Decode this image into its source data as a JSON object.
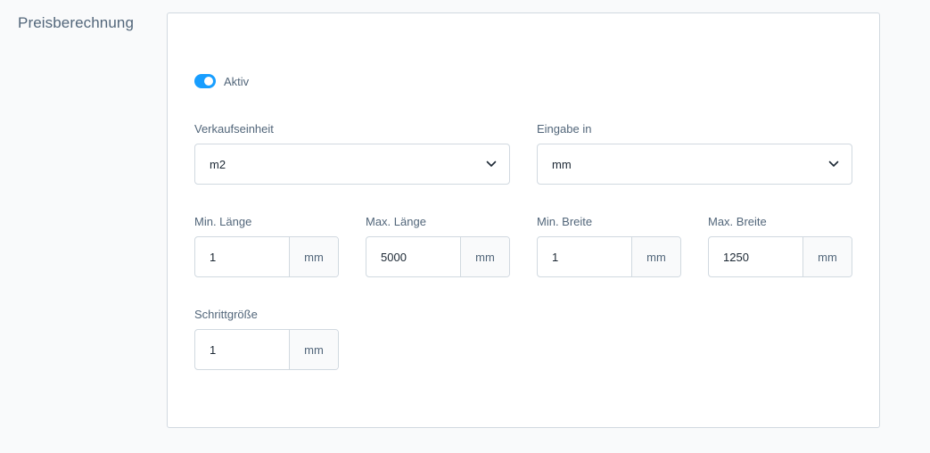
{
  "section": {
    "title": "Preisberechnung"
  },
  "toggle": {
    "label": "Aktiv",
    "checked": true,
    "color": "#189eff"
  },
  "selects": {
    "sales_unit": {
      "label": "Verkaufseinheit",
      "value": "m2",
      "icon": "chevron-down-icon"
    },
    "input_unit": {
      "label": "Eingabe in",
      "value": "mm",
      "icon": "chevron-down-icon"
    }
  },
  "dimensions": {
    "min_length": {
      "label": "Min. Länge",
      "value": "1",
      "unit": "mm"
    },
    "max_length": {
      "label": "Max. Länge",
      "value": "5000",
      "unit": "mm"
    },
    "min_width": {
      "label": "Min. Breite",
      "value": "1",
      "unit": "mm"
    },
    "max_width": {
      "label": "Max. Breite",
      "value": "1250",
      "unit": "mm"
    },
    "step_size": {
      "label": "Schrittgröße",
      "value": "1",
      "unit": "mm"
    }
  }
}
